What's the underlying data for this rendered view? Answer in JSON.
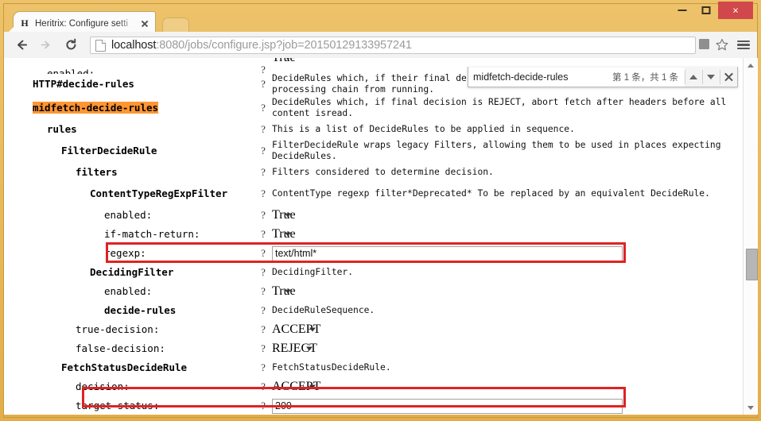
{
  "window": {
    "minimize_label": "Minimize",
    "maximize_label": "Maximize",
    "close_label": "×"
  },
  "tab": {
    "favicon_letter": "H",
    "title": "Heritrix: Configure setti",
    "close_label": "close-tab"
  },
  "toolbar": {
    "back_label": "Back",
    "forward_label": "Forward",
    "reload_label": "Reload",
    "url_host": "localhost",
    "url_rest": ":8080/jobs/configure.jsp?job=20150129133957241",
    "bookmark_label": "Bookmark this page",
    "menu_label": "Customize and control"
  },
  "find_bar": {
    "query": "midfetch-decide-rules",
    "count_text": "第 1 条，共 1 条",
    "prev_label": "Previous",
    "next_label": "Next",
    "close_label": "Close find bar"
  },
  "help_marker": "?",
  "rows": [
    {
      "label": "enabled:",
      "indent": 2,
      "bold": false,
      "highlight": false,
      "type": "select",
      "value": "True",
      "clipped": true,
      "redbox": false
    },
    {
      "label": "HTTP#decide-rules",
      "indent": 1,
      "bold": true,
      "highlight": false,
      "type": "desc",
      "value": "DecideRules which, if their final decision is REJECT, abort fetch and stop this processing chain from running.",
      "redbox": false
    },
    {
      "label": "midfetch-decide-rules",
      "indent": 1,
      "bold": true,
      "highlight": true,
      "type": "desc",
      "value": "DecideRules which, if final decision is REJECT, abort fetch after headers before all content isread.",
      "redbox": false
    },
    {
      "label": "rules",
      "indent": 2,
      "bold": true,
      "highlight": false,
      "type": "desc",
      "value": "This is a list of DecideRules to be applied in sequence.",
      "redbox": false
    },
    {
      "label": "FilterDecideRule",
      "indent": 3,
      "bold": true,
      "highlight": false,
      "type": "desc",
      "value": "FilterDecideRule wraps legacy Filters, allowing them to be used in places expecting DecideRules.",
      "redbox": false
    },
    {
      "label": "filters",
      "indent": 4,
      "bold": true,
      "highlight": false,
      "type": "desc",
      "value": "Filters considered to determine decision.",
      "redbox": false
    },
    {
      "label": "ContentTypeRegExpFilter",
      "indent": 5,
      "bold": true,
      "highlight": false,
      "type": "desc",
      "value": "ContentType regexp filter*Deprecated* To be replaced by an equivalent DecideRule.",
      "redbox": false
    },
    {
      "label": "enabled:",
      "indent": 6,
      "bold": false,
      "highlight": false,
      "type": "select",
      "value": "True",
      "redbox": false
    },
    {
      "label": "if-match-return:",
      "indent": 6,
      "bold": false,
      "highlight": false,
      "type": "select",
      "value": "True",
      "redbox": false
    },
    {
      "label": "regexp:",
      "indent": 6,
      "bold": false,
      "highlight": false,
      "type": "text",
      "value": "text/html*",
      "redbox": true
    },
    {
      "label": "DecidingFilter",
      "indent": 5,
      "bold": true,
      "highlight": false,
      "type": "desc",
      "value": "DecidingFilter.",
      "redbox": false
    },
    {
      "label": "enabled:",
      "indent": 6,
      "bold": false,
      "highlight": false,
      "type": "select",
      "value": "True",
      "redbox": false
    },
    {
      "label": "decide-rules",
      "indent": 6,
      "bold": true,
      "highlight": false,
      "type": "desc",
      "value": "DecideRuleSequence.",
      "redbox": false
    },
    {
      "label": "true-decision:",
      "indent": 4,
      "bold": false,
      "highlight": false,
      "type": "select",
      "value": "ACCEPT",
      "redbox": false
    },
    {
      "label": "false-decision:",
      "indent": 4,
      "bold": false,
      "highlight": false,
      "type": "select",
      "value": "REJECT",
      "redbox": false
    },
    {
      "label": "FetchStatusDecideRule",
      "indent": 3,
      "bold": true,
      "highlight": false,
      "type": "desc",
      "value": "FetchStatusDecideRule.",
      "redbox": false
    },
    {
      "label": "decision:",
      "indent": 4,
      "bold": false,
      "highlight": false,
      "type": "select",
      "value": "ACCEPT",
      "redbox": false
    },
    {
      "label": "target-status:",
      "indent": 4,
      "bold": false,
      "highlight": false,
      "type": "text",
      "value": "200",
      "redbox": true
    }
  ],
  "colors": {
    "window_frame": "#e8b44a",
    "highlight": "#ff9632",
    "annotation": "#e02222",
    "close_button": "#d0484b"
  }
}
